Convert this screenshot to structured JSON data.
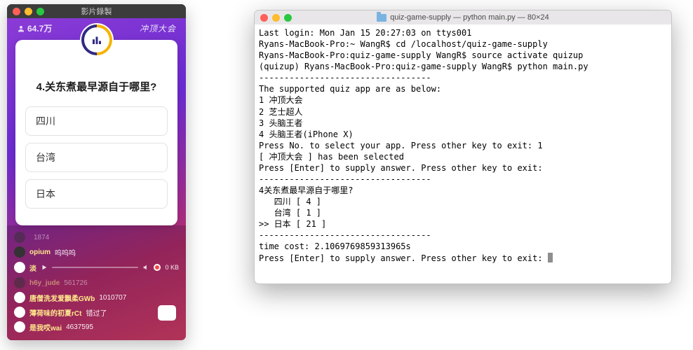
{
  "phone_window": {
    "title": "影片錄製",
    "viewers": "64.7万",
    "brand": "冲顶大会",
    "question": "4.关东煮最早源自于哪里?",
    "options": [
      "四川",
      "台湾",
      "日本"
    ],
    "chat": [
      {
        "user": "",
        "text": "1874",
        "obscured": true
      },
      {
        "user": "opium",
        "text": "呜呜呜"
      },
      {
        "user": "淡",
        "text": ""
      },
      {
        "user": "h6y_jude",
        "text": "561726",
        "obscured": true
      },
      {
        "user": "唐僧洗发爱飘柔GWb",
        "text": "1010707"
      },
      {
        "user": "薄荷味的初夏rCt",
        "text": "错过了"
      },
      {
        "user": "是我哎wai",
        "text": "4637595"
      }
    ],
    "audio_size": "0 KB"
  },
  "terminal": {
    "title": "quiz-game-supply — python main.py — 80×24",
    "lines": [
      "Last login: Mon Jan 15 20:27:03 on ttys001",
      "Ryans-MacBook-Pro:~ WangR$ cd /localhost/quiz-game-supply",
      "Ryans-MacBook-Pro:quiz-game-supply WangR$ source activate quizup",
      "(quizup) Ryans-MacBook-Pro:quiz-game-supply WangR$ python main.py",
      "----------------------------------",
      "The supported quiz app are as below:",
      "1 冲顶大会",
      "2 芝士超人",
      "3 头脑王者",
      "4 头脑王者(iPhone X)",
      "Press No. to select your app. Press other key to exit: 1",
      "[ 冲顶大会 ] has been selected",
      "Press [Enter] to supply answer. Press other key to exit:",
      "----------------------------------",
      "4关东煮最早源自于哪里?",
      "   四川 [ 4 ]",
      "   台湾 [ 1 ]",
      ">> 日本 [ 21 ]",
      "----------------------------------",
      "time cost: 2.1069769859313965s",
      "Press [Enter] to supply answer. Press other key to exit: "
    ]
  }
}
